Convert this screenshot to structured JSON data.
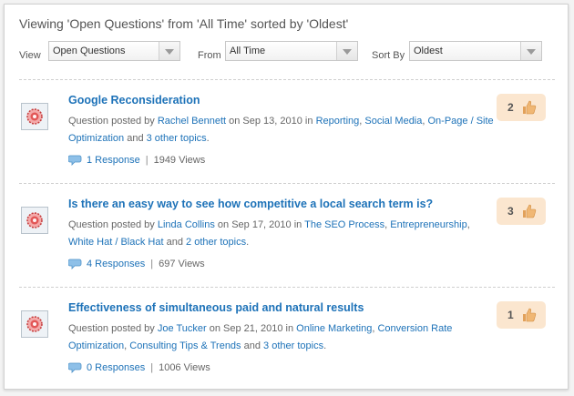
{
  "heading": "Viewing 'Open Questions' from 'All Time' sorted by 'Oldest'",
  "filters": {
    "view": {
      "label": "View",
      "value": "Open Questions"
    },
    "from": {
      "label": "From",
      "value": "All Time"
    },
    "sort": {
      "label": "Sort By",
      "value": "Oldest"
    }
  },
  "questions": [
    {
      "title": "Google Reconsideration",
      "prefix": "Question posted by",
      "author": "Rachel Bennett",
      "on": "on Sep 13, 2010 in",
      "topics": [
        "Reporting",
        "Social Media",
        "On-Page / Site Optimization"
      ],
      "and": "and",
      "other_topics": "3 other topics",
      "responses": "1 Response",
      "views": "1949 Views",
      "votes": "2"
    },
    {
      "title": "Is there an easy way to see how competitive a local search term is?",
      "prefix": "Question posted by",
      "author": "Linda Collins",
      "on": "on Sep 17, 2010 in",
      "topics": [
        "The SEO Process",
        "Entrepreneurship",
        "White Hat / Black Hat"
      ],
      "and": "and",
      "other_topics": "2 other topics",
      "responses": "4 Responses",
      "views": "697 Views",
      "votes": "3"
    },
    {
      "title": "Effectiveness of simultaneous paid and natural results",
      "prefix": "Question posted by",
      "author": "Joe Tucker",
      "on": "on Sep 21, 2010 in",
      "topics": [
        "Online Marketing",
        "Conversion Rate Optimization",
        "Consulting Tips & Trends"
      ],
      "and": "and",
      "other_topics": "3 other topics",
      "responses": "0 Responses",
      "views": "1006 Views",
      "votes": "1"
    }
  ],
  "icons": {
    "avatar": "flower-avatar-icon",
    "responses": "speech-bubble-icon",
    "votes": "thumbs-up-icon"
  },
  "colors": {
    "link": "#1d72b8",
    "vote_bg": "#fbe6cf",
    "thumb": "#e2a15a"
  }
}
